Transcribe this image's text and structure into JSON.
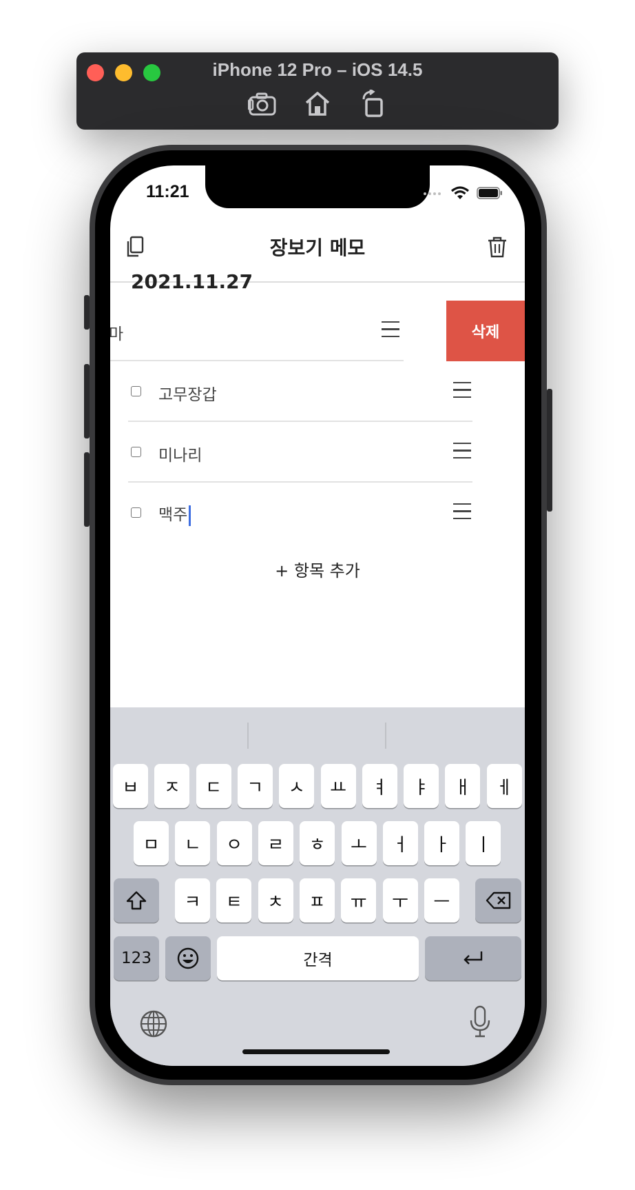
{
  "simulator": {
    "title": "iPhone 12 Pro – iOS 14.5",
    "tools": [
      "screenshot-icon",
      "home-icon",
      "rotate-icon"
    ]
  },
  "status_bar": {
    "time": "11:21",
    "icons": [
      "signal-icon",
      "wifi-icon",
      "battery-icon"
    ]
  },
  "header": {
    "title": "장보기 메모",
    "left_icon": "copy-icon",
    "right_icon": "trash-icon"
  },
  "memo": {
    "date": "2021.11.27",
    "items": [
      {
        "text": "마",
        "checked": false,
        "swiped": true
      },
      {
        "text": "고무장갑",
        "checked": false
      },
      {
        "text": "미나리",
        "checked": false
      },
      {
        "text": "맥주",
        "checked": false,
        "editing": true
      }
    ],
    "delete_label": "삭제",
    "add_label": "+ 항목 추가"
  },
  "keyboard": {
    "row1": [
      "ㅂ",
      "ㅈ",
      "ㄷ",
      "ㄱ",
      "ㅅ",
      "ㅛ",
      "ㅕ",
      "ㅑ",
      "ㅐ",
      "ㅔ"
    ],
    "row2": [
      "ㅁ",
      "ㄴ",
      "ㅇ",
      "ㄹ",
      "ㅎ",
      "ㅗ",
      "ㅓ",
      "ㅏ",
      "ㅣ"
    ],
    "row3": [
      "ㅋ",
      "ㅌ",
      "ㅊ",
      "ㅍ",
      "ㅠ",
      "ㅜ",
      "ㅡ"
    ],
    "numbers_label": "123",
    "space_label": "간격",
    "icons": [
      "shift-icon",
      "backspace-icon",
      "emoji-icon",
      "return-icon",
      "globe-icon",
      "mic-icon"
    ]
  },
  "colors": {
    "delete": "#de5446",
    "caret": "#3e6ee0",
    "keyboard_bg": "#d5d7dd"
  }
}
